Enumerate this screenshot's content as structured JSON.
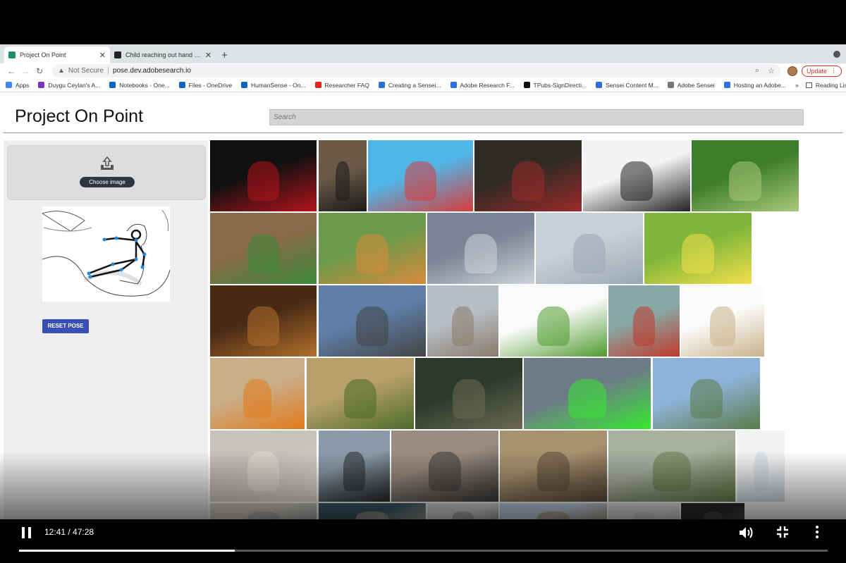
{
  "tabs": [
    {
      "title": "Project On Point",
      "favicon_color": "#1e8c6e",
      "active": true
    },
    {
      "title": "Child reaching out hand stock",
      "favicon_color": "#222222",
      "active": false
    }
  ],
  "address": {
    "security": "Not Secure",
    "url": "pose.dev.adobesearch.io",
    "update_label": "Update"
  },
  "bookmarks": [
    {
      "label": "Apps",
      "color": "#4285f4"
    },
    {
      "label": "Duygu Ceylan's A...",
      "color": "#7b2fbf"
    },
    {
      "label": "Notebooks - One...",
      "color": "#0a66c2"
    },
    {
      "label": "Files - OneDrive",
      "color": "#0a66c2"
    },
    {
      "label": "HumanSense - On...",
      "color": "#0a66c2"
    },
    {
      "label": "Researcher FAQ",
      "color": "#e1251b"
    },
    {
      "label": "Creating a Sensei...",
      "color": "#2d6ee0"
    },
    {
      "label": "Adobe Research F...",
      "color": "#2d6ee0"
    },
    {
      "label": "TPubs-SignDirecti...",
      "color": "#111111"
    },
    {
      "label": "Sensei Content M...",
      "color": "#2d6ee0"
    },
    {
      "label": "Adobe Sensei",
      "color": "#777777"
    },
    {
      "label": "Hosting an Adobe...",
      "color": "#2d6ee0"
    }
  ],
  "bookmarks_more": "»",
  "reading_list": "Reading List",
  "site": {
    "title": "Project On Point",
    "search_placeholder": "Search"
  },
  "sidebar": {
    "choose_label": "Choose image",
    "reset_label": "RESET POSE"
  },
  "video": {
    "time": "12:41 / 47:28",
    "progress": 0.267
  },
  "photos": [
    {
      "colors": [
        "#111",
        "#b5121b"
      ]
    },
    {
      "colors": [
        "#6b5a48",
        "#1a1a1a"
      ]
    },
    {
      "colors": [
        "#4fb6e8",
        "#d83b3b"
      ]
    },
    {
      "colors": [
        "#2f2a24",
        "#9b2a2a"
      ]
    },
    {
      "colors": [
        "#f4f4f4",
        "#222"
      ]
    },
    {
      "colors": [
        "#3e7d2a",
        "#a9c97a"
      ]
    },
    {
      "colors": [
        "#8a6a48",
        "#3c8a3c"
      ]
    },
    {
      "colors": [
        "#6a9a4a",
        "#d88a3a"
      ]
    },
    {
      "colors": [
        "#7a8494",
        "#cfd4da"
      ]
    },
    {
      "colors": [
        "#c8cfd6",
        "#9aa8b4"
      ]
    },
    {
      "colors": [
        "#7fb63a",
        "#f2e04a"
      ]
    },
    {
      "colors": [
        "#4a2a16",
        "#b0702a"
      ]
    },
    {
      "colors": [
        "#5f7fa8",
        "#444"
      ]
    },
    {
      "colors": [
        "#b7bfc6",
        "#8a7a6a"
      ]
    },
    {
      "colors": [
        "#fafafa",
        "#4f9a2e"
      ]
    },
    {
      "colors": [
        "#87a9a5",
        "#c0392b"
      ]
    },
    {
      "colors": [
        "#fbfbfb",
        "#c8b28a"
      ]
    },
    {
      "colors": [
        "#c9ae8a",
        "#e27a1a"
      ]
    },
    {
      "colors": [
        "#b7a06a",
        "#4a6a2a"
      ]
    },
    {
      "colors": [
        "#2b3a2c",
        "#6c6a52"
      ]
    },
    {
      "colors": [
        "#6e7a88",
        "#35e82f"
      ]
    },
    {
      "colors": [
        "#8fb3d8",
        "#5a7a48"
      ]
    },
    {
      "colors": [
        "#c6c2bc",
        "#e9e3db"
      ]
    },
    {
      "colors": [
        "#8a9aa8",
        "#2a2a2a"
      ]
    },
    {
      "colors": [
        "#9a8c80",
        "#3a3a3a"
      ]
    },
    {
      "colors": [
        "#a89270",
        "#5a4a3a"
      ]
    },
    {
      "colors": [
        "#aab0a0",
        "#6a7a4a"
      ]
    },
    {
      "colors": [
        "#f2f2f2",
        "#cfd9e2"
      ]
    },
    {
      "colors": [
        "#d8d2c8",
        "#9aa2a8"
      ]
    },
    {
      "colors": [
        "#3a5a6a",
        "#c8b8a0"
      ]
    },
    {
      "colors": [
        "#d8dce0",
        "#8a8a8a"
      ]
    },
    {
      "colors": [
        "#c8d8e8",
        "#a08a6a"
      ]
    },
    {
      "colors": [
        "#e8e8e8",
        "#c8c8c8"
      ]
    },
    {
      "colors": [
        "#2a2a2a",
        "#585858"
      ]
    }
  ]
}
